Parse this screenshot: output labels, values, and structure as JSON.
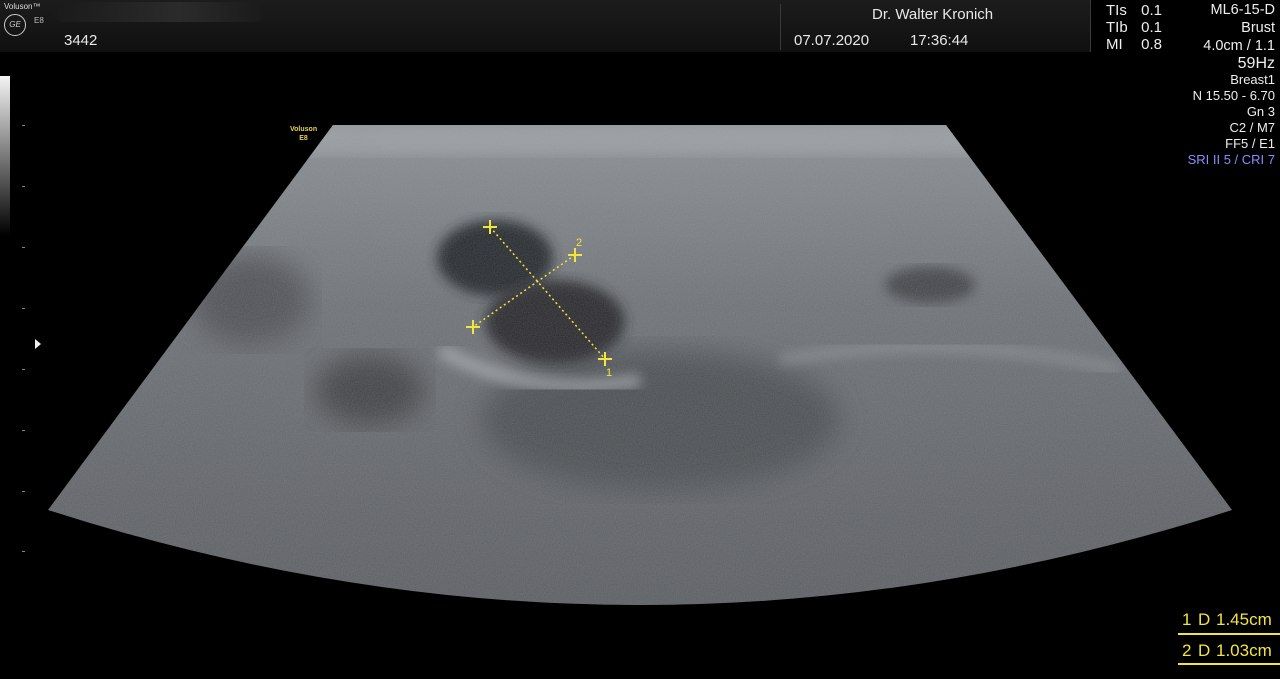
{
  "header": {
    "brand": "Voluson™",
    "brand_model": "E8",
    "logo_text": "GE",
    "patient_id": "3442",
    "doctor": "Dr. Walter Kronich",
    "date": "07.07.2020",
    "time": "17:36:44"
  },
  "safety": [
    {
      "label": "TIs",
      "value": "0.1"
    },
    {
      "label": "TIb",
      "value": "0.1"
    },
    {
      "label": "MI",
      "value": "0.8"
    }
  ],
  "probe": {
    "name": "ML6-15-D",
    "application": "Brust",
    "depth_zoom": "4.0cm / 1.1",
    "frame_rate": "59Hz"
  },
  "params": [
    "Breast1",
    "N 15.50 - 6.70",
    "Gn  3",
    "C2 / M7",
    "FF5 / E1"
  ],
  "sri": "SRI II 5 / CRI 7",
  "image_tag": {
    "line1": "Voluson",
    "line2": "E8"
  },
  "calipers": {
    "label1": "1",
    "label2": "2"
  },
  "measurements": [
    {
      "num": "1",
      "type": "D",
      "value": "1.45cm"
    },
    {
      "num": "2",
      "type": "D",
      "value": "1.03cm"
    }
  ],
  "colors": {
    "caliper": "#f2e53c",
    "sri": "#8a8cff"
  }
}
